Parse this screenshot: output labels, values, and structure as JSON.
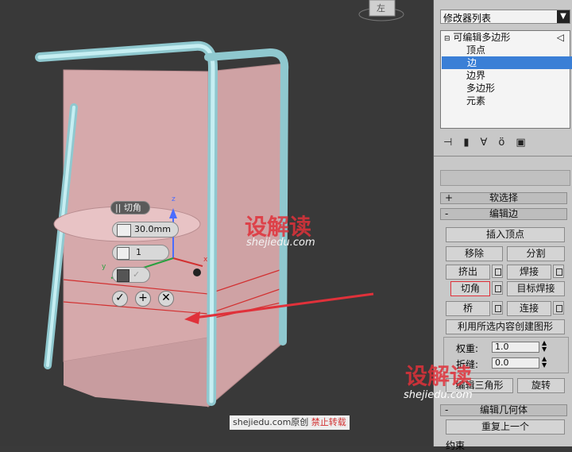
{
  "modifier_list": {
    "label": "修改器列表"
  },
  "stack": {
    "items": [
      {
        "label": "可编辑多边形"
      },
      {
        "label": "顶点"
      },
      {
        "label": "边"
      },
      {
        "label": "边界"
      },
      {
        "label": "多边形"
      },
      {
        "label": "元素"
      }
    ]
  },
  "rollouts": {
    "soft_select": "软选择",
    "edit_edges": "编辑边",
    "edit_geometry": "编辑几何体",
    "constraints": "约束"
  },
  "edit_edges": {
    "insert_vertex": "插入顶点",
    "remove": "移除",
    "split": "分割",
    "extrude": "挤出",
    "weld": "焊接",
    "chamfer": "切角",
    "target_weld": "目标焊接",
    "bridge": "桥",
    "connect": "连接",
    "create_shape": "利用所选内容创建图形",
    "weight_label": "权重:",
    "weight_value": "1.0",
    "crease_label": "折缝:",
    "crease_value": "0.0",
    "edit_triangles": "编辑三角形",
    "turn": "旋转"
  },
  "edit_geometry": {
    "repeat_last": "重复上一个"
  },
  "caddy": {
    "title": "切角",
    "amount": "30.0mm",
    "segments": "1",
    "ok": "✓",
    "apply": "+",
    "cancel": "✕"
  },
  "viewcube": {
    "label": "左"
  },
  "axis": {
    "z": "z",
    "x": "x",
    "y": "y"
  },
  "watermark": {
    "brand": "设解读",
    "site": "shejiedu.com",
    "credit_site": "shejiedu.com原创",
    "credit_warning": "禁止转载"
  },
  "colors": {
    "selection": "#3a7fd6",
    "viewport_bg": "#393939",
    "mesh": "#d8aeb0",
    "frame": "#a8dde2",
    "arrow": "#e0313a"
  }
}
